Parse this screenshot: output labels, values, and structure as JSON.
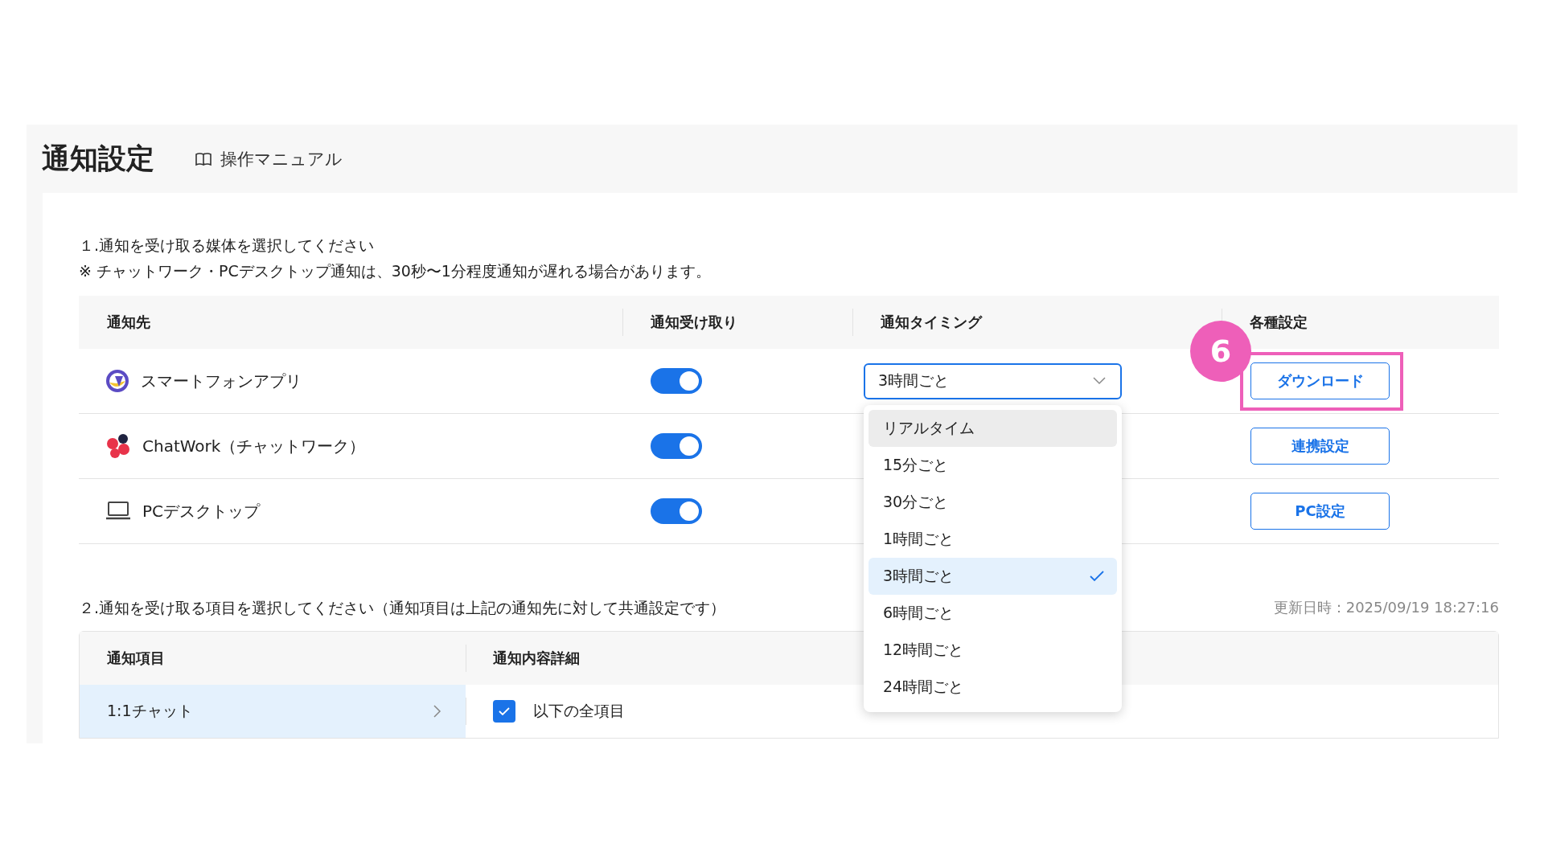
{
  "page": {
    "title": "通知設定",
    "manual_link": "操作マニュアル"
  },
  "section1": {
    "heading": "１.通知を受け取る媒体を選択してください",
    "note": "※ チャットワーク・PCデスクトップ通知は、30秒〜1分程度通知が遅れる場合があります。"
  },
  "channels_table": {
    "columns": [
      "通知先",
      "通知受け取り",
      "通知タイミング",
      "各種設定"
    ],
    "rows": [
      {
        "kind": "app",
        "name": "スマートフォンアプリ",
        "on": true,
        "timing": "3時間ごと",
        "action": "ダウンロード"
      },
      {
        "kind": "chatwork",
        "name": "ChatWork（チャットワーク）",
        "on": true,
        "action": "連携設定"
      },
      {
        "kind": "desktop",
        "name": "PCデスクトップ",
        "on": true,
        "action": "PC設定"
      }
    ]
  },
  "timing_dropdown": {
    "options": [
      {
        "label": "リアルタイム",
        "selected": false,
        "highlighted": true
      },
      {
        "label": "15分ごと",
        "selected": false,
        "highlighted": false
      },
      {
        "label": "30分ごと",
        "selected": false,
        "highlighted": false
      },
      {
        "label": "1時間ごと",
        "selected": false,
        "highlighted": false
      },
      {
        "label": "3時間ごと",
        "selected": true,
        "highlighted": false
      },
      {
        "label": "6時間ごと",
        "selected": false,
        "highlighted": false
      },
      {
        "label": "12時間ごと",
        "selected": false,
        "highlighted": false
      },
      {
        "label": "24時間ごと",
        "selected": false,
        "highlighted": false
      }
    ]
  },
  "callout": {
    "number": "6"
  },
  "section2": {
    "heading": "２.通知を受け取る項目を選択してください（通知項目は上記の通知先に対して共通設定です）",
    "updated": "更新日時：2025/09/19 18:27:16",
    "columns": [
      "通知項目",
      "通知内容詳細"
    ],
    "items": [
      {
        "label": "1:1チャット",
        "selected": true
      }
    ],
    "details": [
      {
        "label": "以下の全項目",
        "checked": true
      }
    ]
  }
}
